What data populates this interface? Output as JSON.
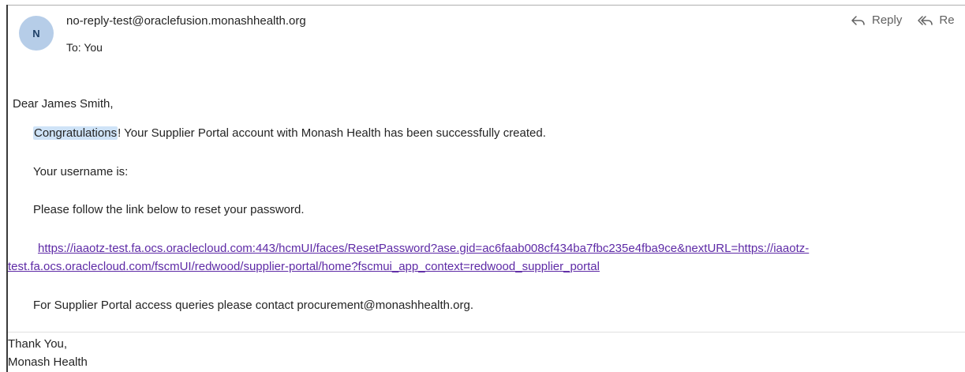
{
  "email": {
    "avatar_initial": "N",
    "sender": "no-reply-test@oraclefusion.monashhealth.org",
    "to_line": "To: You",
    "actions": {
      "reply_label": "Reply",
      "reply_all_label": "Re"
    },
    "body": {
      "greeting": "Dear James Smith,",
      "congrats_word": "Congratulations",
      "congrats_rest": "! Your Supplier Portal account with Monash Health has been successfully created.",
      "username_line": "Your username is:",
      "reset_instruction": "Please follow the link below to reset your password.",
      "reset_link_line1": "https://iaaotz-test.fa.ocs.oraclecloud.com:443/hcmUI/faces/ResetPassword?ase.gid=ac6faab008cf434ba7fbc235e4fba9ce&nextURL=https://iaaotz-",
      "reset_link_line2": "test.fa.ocs.oraclecloud.com/fscmUI/redwood/supplier-portal/home?fscmui_app_context=redwood_supplier_portal",
      "contact_line": "For Supplier Portal access queries please contact procurement@monashhealth.org.",
      "closing": "Thank You,",
      "signature": "Monash Health"
    }
  },
  "colors": {
    "avatar_bg": "#b6cde8",
    "link": "#5e2aa6",
    "highlight": "#cfe3f7"
  }
}
